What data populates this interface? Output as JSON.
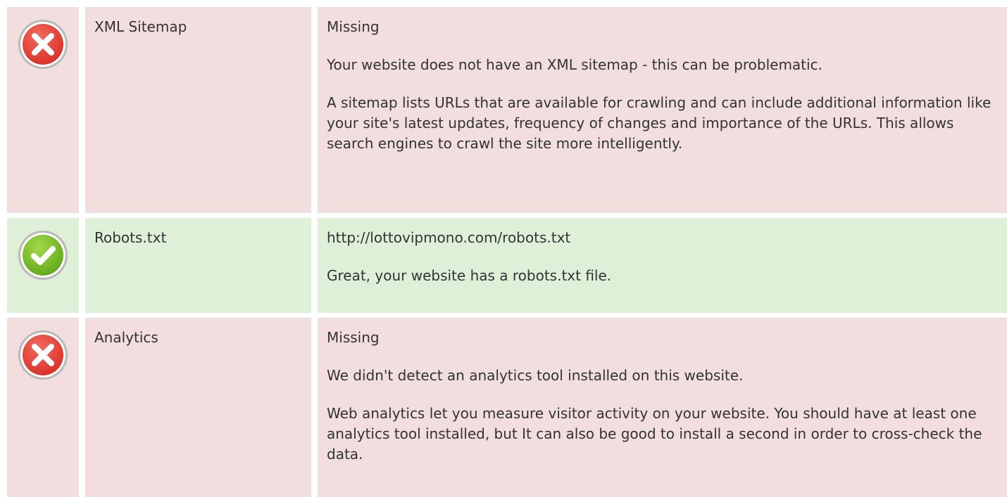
{
  "rows": [
    {
      "status": "error",
      "icon": "error-x-icon",
      "name": "XML Sitemap",
      "lines": [
        "Missing",
        "Your website does not have an XML sitemap - this can be problematic.",
        "A sitemap lists URLs that are available for crawling and can include additional information like your site's latest updates, frequency of changes and importance of the URLs. This allows search engines to crawl the site more intelligently."
      ]
    },
    {
      "status": "success",
      "icon": "success-check-icon",
      "name": "Robots.txt",
      "lines": [
        "http://lottovipmono.com/robots.txt",
        "Great, your website has a robots.txt file."
      ]
    },
    {
      "status": "error",
      "icon": "error-x-icon",
      "name": "Analytics",
      "lines": [
        "Missing",
        "We didn't detect an analytics tool installed on this website.",
        "Web analytics let you measure visitor activity on your website. You should have at least one analytics tool installed, but It can also be good to install a second in order to cross-check the data."
      ]
    }
  ],
  "colors": {
    "error_bg": "#f2dede",
    "success_bg": "#dff0d8",
    "error_icon": "#e8413a",
    "success_icon": "#7cc02a"
  }
}
